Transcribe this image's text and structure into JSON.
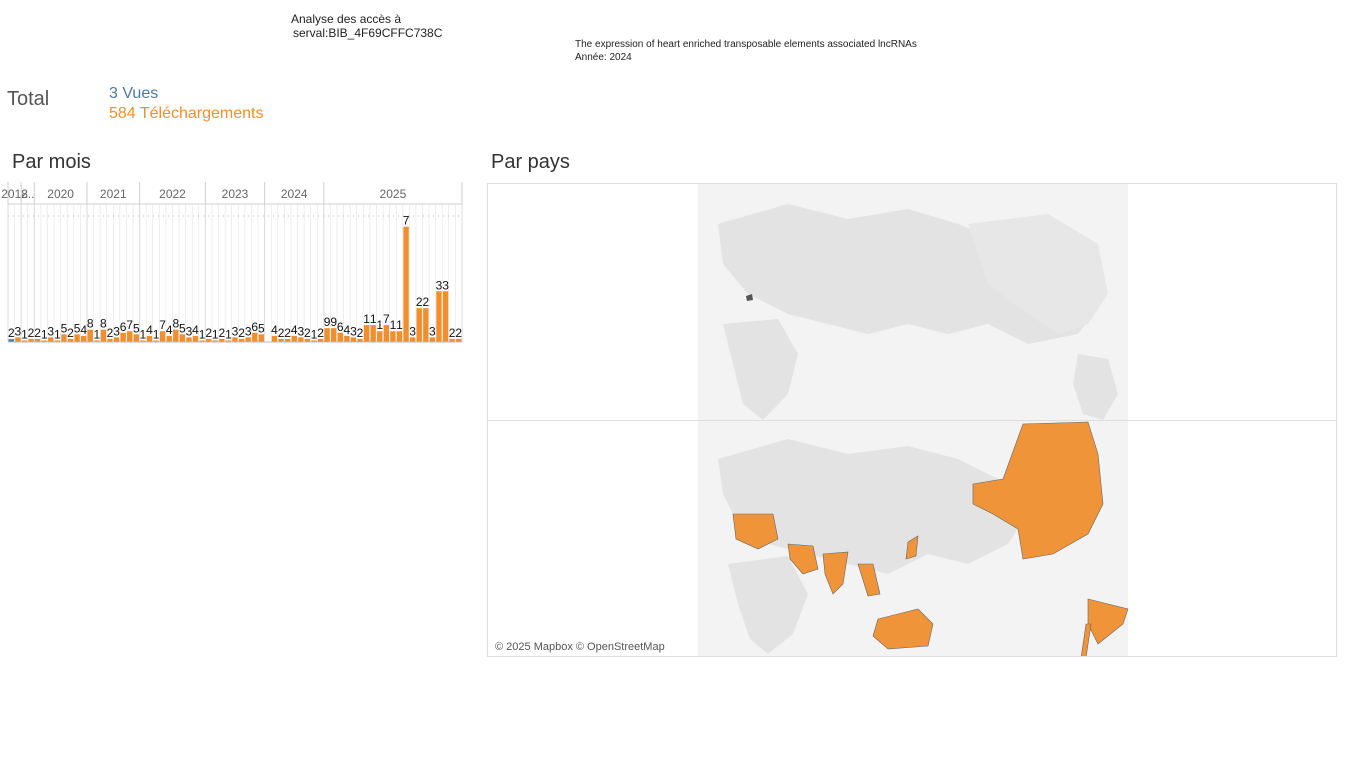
{
  "header": {
    "title": "Analyse des accès à",
    "record_id": "serval:BIB_4F69CFFC738C"
  },
  "document": {
    "title": "The expression of heart enriched transposable elements associated lncRNAs",
    "year": "Année: 2024"
  },
  "totals": {
    "label": "Total",
    "views": "3 Vues",
    "downloads": "584 Téléchargements"
  },
  "sections": {
    "by_month": "Par mois",
    "by_country": "Par pays"
  },
  "colors": {
    "views": "#4e79a7",
    "downloads": "#f28e2b",
    "highlight_country": "#f0943a",
    "land": "#e6e6e6"
  },
  "chart_data": {
    "type": "bar",
    "year_headers": [
      "2018",
      "2..",
      "2020",
      "2021",
      "2022",
      "2023",
      "2024",
      "2025"
    ],
    "series": [
      {
        "name": "Vues",
        "values": [
          1,
          0,
          0,
          0,
          0,
          0,
          0,
          0,
          0,
          0,
          0,
          0,
          0,
          0,
          0,
          0,
          0,
          0,
          0,
          0,
          0,
          0,
          0,
          0,
          0,
          0,
          0,
          0,
          0,
          0,
          0,
          0,
          0,
          0,
          0,
          0,
          0,
          0,
          0,
          0,
          0,
          0,
          0,
          0,
          0,
          0,
          0,
          0,
          0,
          0,
          0,
          0,
          0,
          0,
          0,
          0,
          0,
          0,
          0,
          0,
          0,
          0,
          0,
          0,
          0,
          0,
          0,
          0,
          0,
          1,
          0,
          0,
          0,
          0,
          0,
          0,
          0,
          0,
          0,
          0,
          0,
          0,
          0,
          1,
          0,
          0,
          0,
          0
        ]
      },
      {
        "name": "Téléchargements",
        "values": [
          2,
          3,
          1,
          2,
          2,
          1,
          3,
          1,
          5,
          2,
          5,
          4,
          8,
          1,
          8,
          2,
          3,
          6,
          7,
          5,
          1,
          4,
          1,
          7,
          4,
          8,
          5,
          3,
          4,
          1,
          2,
          1,
          2,
          1,
          3,
          2,
          3,
          6,
          5,
          0,
          4,
          2,
          2,
          4,
          3,
          2,
          1,
          2,
          9,
          9,
          6,
          4,
          3,
          2,
          11,
          11,
          7,
          11,
          7,
          7,
          75,
          3,
          22,
          22,
          3,
          33,
          33,
          2,
          2
        ]
      },
      {
        "name": "labels",
        "values": [
          "2",
          "3",
          "1",
          "2",
          "2",
          "1",
          "3",
          "1",
          "5",
          "2",
          "5",
          "4",
          "8",
          "1",
          "8",
          "2",
          "3",
          "6",
          "7",
          "5",
          "1",
          "4",
          "1",
          "7",
          "4",
          "8",
          "5",
          "3",
          "4",
          "1",
          "2",
          "1",
          "2",
          "1",
          "3",
          "2",
          "3",
          "6",
          "5",
          "",
          "4",
          "2",
          "2",
          "4",
          "3",
          "2",
          "1",
          "2",
          "9",
          "9",
          "6",
          "4",
          "3",
          "2",
          "1",
          "1",
          "1",
          "7",
          "1",
          "1",
          "7",
          "3",
          "2",
          "2",
          "3",
          "3",
          "3",
          "2",
          "2"
        ]
      }
    ],
    "ylim": [
      0,
      80
    ]
  },
  "map": {
    "credit": "© 2025 Mapbox © OpenStreetMap"
  }
}
